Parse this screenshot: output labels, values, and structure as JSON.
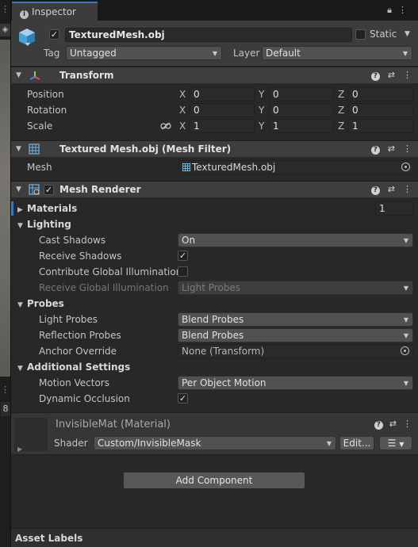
{
  "tab": {
    "label": "Inspector"
  },
  "header": {
    "name": "TexturedMesh.obj",
    "static_label": "Static",
    "tag_label": "Tag",
    "tag_value": "Untagged",
    "layer_label": "Layer",
    "layer_value": "Default"
  },
  "transform": {
    "title": "Transform",
    "position": {
      "label": "Position",
      "x": "0",
      "y": "0",
      "z": "0"
    },
    "rotation": {
      "label": "Rotation",
      "x": "0",
      "y": "0",
      "z": "0"
    },
    "scale": {
      "label": "Scale",
      "x": "1",
      "y": "1",
      "z": "1"
    },
    "axes": {
      "x": "X",
      "y": "Y",
      "z": "Z"
    }
  },
  "mesh_filter": {
    "title": "Textured Mesh.obj (Mesh Filter)",
    "mesh_label": "Mesh",
    "mesh_value": "TexturedMesh.obj"
  },
  "mesh_renderer": {
    "title": "Mesh Renderer",
    "materials_label": "Materials",
    "materials_count": "1",
    "lighting_label": "Lighting",
    "cast_shadows_label": "Cast Shadows",
    "cast_shadows_value": "On",
    "receive_shadows_label": "Receive Shadows",
    "contribute_gi_label": "Contribute Global Illumination",
    "receive_gi_label": "Receive Global Illumination",
    "receive_gi_value": "Light Probes",
    "probes_label": "Probes",
    "light_probes_label": "Light Probes",
    "light_probes_value": "Blend Probes",
    "reflection_probes_label": "Reflection Probes",
    "reflection_probes_value": "Blend Probes",
    "anchor_override_label": "Anchor Override",
    "anchor_override_value": "None (Transform)",
    "additional_label": "Additional Settings",
    "motion_vectors_label": "Motion Vectors",
    "motion_vectors_value": "Per Object Motion",
    "dynamic_occlusion_label": "Dynamic Occlusion"
  },
  "material": {
    "title": "InvisibleMat (Material)",
    "shader_label": "Shader",
    "shader_value": "Custom/InvisibleMask",
    "edit_label": "Edit..."
  },
  "add_component_label": "Add Component",
  "asset_labels": "Asset Labels",
  "left_panel_number": "8",
  "colors": {
    "accent": "#3a79bb",
    "panel_bg": "#282828",
    "header_bg": "#3e3e3e"
  }
}
